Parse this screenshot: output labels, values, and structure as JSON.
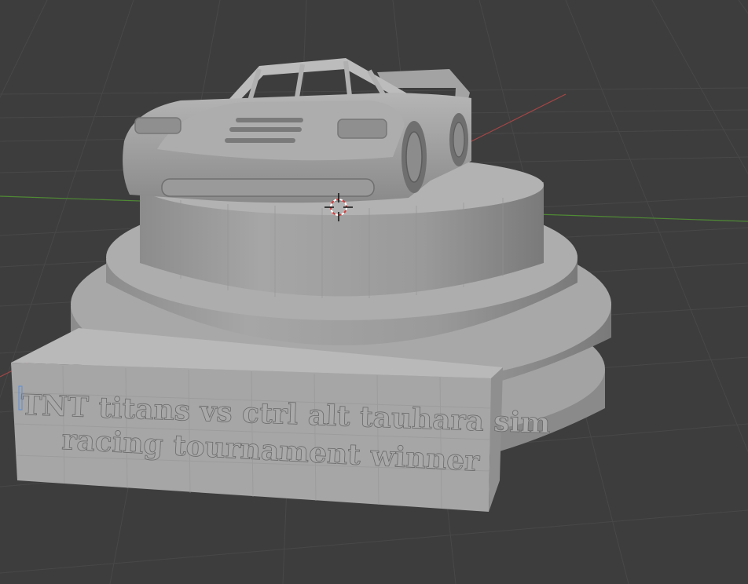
{
  "viewport": {
    "background_color": "#3d3d3d",
    "grid_color": "#4a4a4a",
    "x_axis_color": "#b04040",
    "y_axis_color": "#5a8f3a",
    "model_color": "#9b9b9b"
  },
  "plaque": {
    "line1": "TNT titans vs ctrl alt tauhara sim",
    "line2": "racing tournament winner"
  },
  "cursor_3d": {
    "icon": "3d-cursor-icon"
  }
}
